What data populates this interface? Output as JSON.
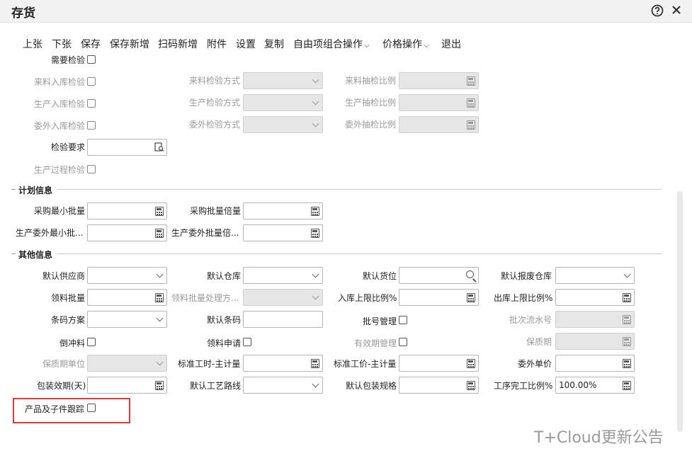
{
  "window": {
    "title": "存货",
    "help_icon": "help-circle-icon",
    "close_icon": "close-icon"
  },
  "toolbar": {
    "items": [
      {
        "label": "上张"
      },
      {
        "label": "下张"
      },
      {
        "label": "保存"
      },
      {
        "label": "保存新增"
      },
      {
        "label": "扫码新增"
      },
      {
        "label": "附件"
      },
      {
        "label": "设置"
      },
      {
        "label": "复制"
      },
      {
        "label": "自由项组合操作",
        "dropdown": true
      },
      {
        "label": "价格操作",
        "dropdown": true
      },
      {
        "label": "退出"
      }
    ]
  },
  "inspection": {
    "need_inspection": "需要检验",
    "incoming_inspection": "来料入库检验",
    "incoming_method": "来料检验方式",
    "incoming_ratio": "来料抽检比例",
    "production_inspection": "生产入库检验",
    "production_method": "生产检验方式",
    "production_ratio": "生产抽检比例",
    "outsource_inspection": "委外入库检验",
    "outsource_method": "委外检验方式",
    "outsource_ratio": "委外抽检比例",
    "requirement": "检验要求",
    "process_inspection": "生产过程检验"
  },
  "plan": {
    "section_title": "计划信息",
    "min_purchase": "采购最小批量",
    "purchase_multiple": "采购批量倍量",
    "min_production": "生产委外最小批...",
    "production_multiple": "生产委外批量倍..."
  },
  "other": {
    "section_title": "其他信息",
    "default_supplier": "默认供应商",
    "default_warehouse": "默认仓库",
    "default_location": "默认货位",
    "default_scrap_warehouse": "默认报废仓库",
    "picking_batch": "领料批量",
    "picking_batch_method": "领料批量处理方...",
    "inbound_limit": "入库上限比例%",
    "outbound_limit": "出库上限比例%",
    "barcode_scheme": "条码方案",
    "default_barcode": "默认条码",
    "batch_mgmt": "批号管理",
    "batch_serial": "批次流水号",
    "backflush": "倒冲料",
    "picking_request": "领料申请",
    "expiry_mgmt": "有效期管理",
    "shelf_life": "保质期",
    "shelf_life_unit": "保质期单位",
    "std_hours": "标准工时-主计量",
    "std_price": "标准工价-主计量",
    "outsource_price": "委外单价",
    "pack_expiry": "包装效期(天)",
    "default_route": "默认工艺路线",
    "default_pack_spec": "默认包装规格",
    "process_completion": "工序完工比例%",
    "process_completion_value": "100.00%",
    "track_product": "产品及子件跟踪"
  },
  "watermark": "T+Cloud更新公告"
}
